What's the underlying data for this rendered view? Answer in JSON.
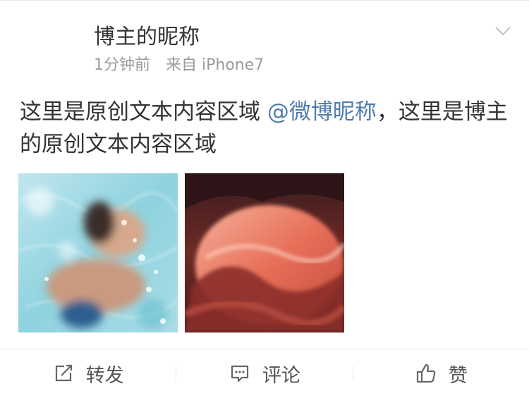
{
  "post": {
    "nickname": "博主的昵称",
    "time": "1分钟前",
    "source": "来自 iPhone7",
    "text_before": "这里是原创文本内容区域 ",
    "mention": "@微博昵称",
    "text_after": "，这里是博主的原创文本内容区域"
  },
  "images": [
    {
      "subject": "swimmer underwater in pool"
    },
    {
      "subject": "red slot canyon"
    }
  ],
  "actions": {
    "repost_label": "转发",
    "comment_label": "评论",
    "like_label": "赞"
  },
  "colors": {
    "link": "#4f7cae",
    "meta": "#9b9b9b",
    "text": "#333333"
  },
  "icons": {
    "more": "chevron-down-icon",
    "repost": "repost-icon",
    "comment": "comment-icon",
    "like": "thumbs-up-icon"
  }
}
